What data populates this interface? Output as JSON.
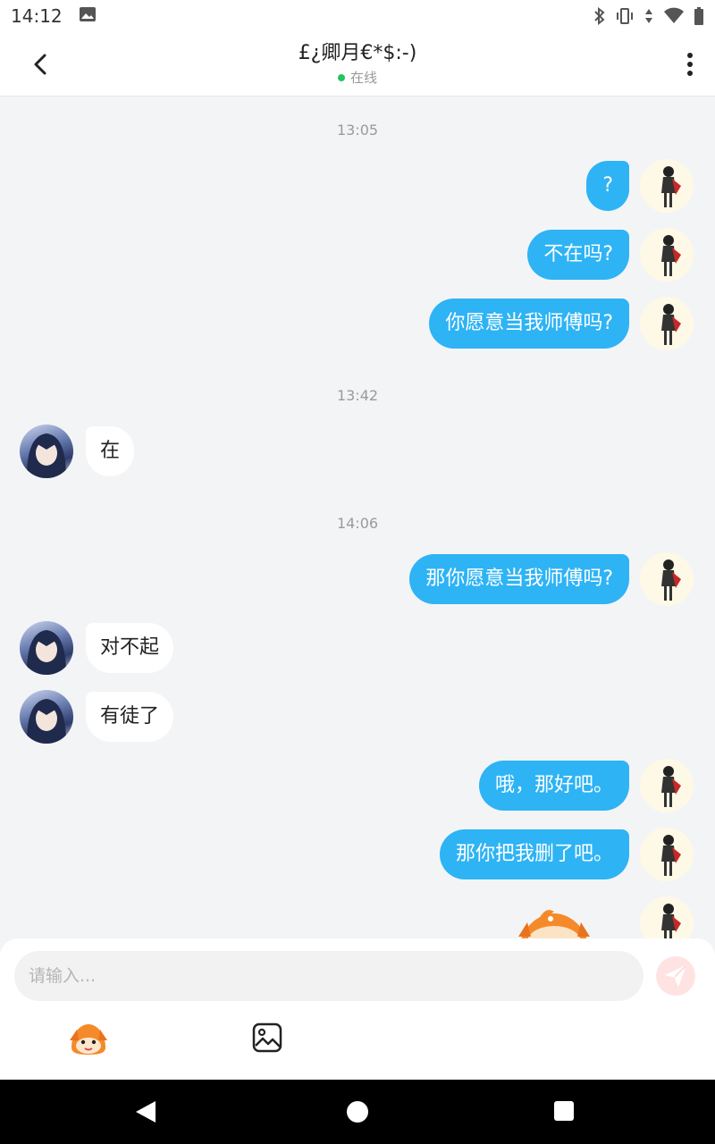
{
  "status_bar": {
    "time": "14:12"
  },
  "header": {
    "title": "£¿卿月€*$:-)",
    "status": "在线"
  },
  "messages": {
    "t1": "13:05",
    "m1": "?",
    "m2": "不在吗?",
    "m3": "你愿意当我师傅吗?",
    "t2": "13:42",
    "m4": "在",
    "t3": "14:06",
    "m5": "那你愿意当我师傅吗?",
    "m6": "对不起",
    "m7": "有徒了",
    "m8": "哦，那好吧。",
    "m9": "那你把我删了吧。"
  },
  "composer": {
    "placeholder": "请输入..."
  },
  "colors": {
    "outgoing_bubble": "#2eb3f5",
    "incoming_bubble": "#ffffff",
    "online_dot": "#22c55e"
  }
}
